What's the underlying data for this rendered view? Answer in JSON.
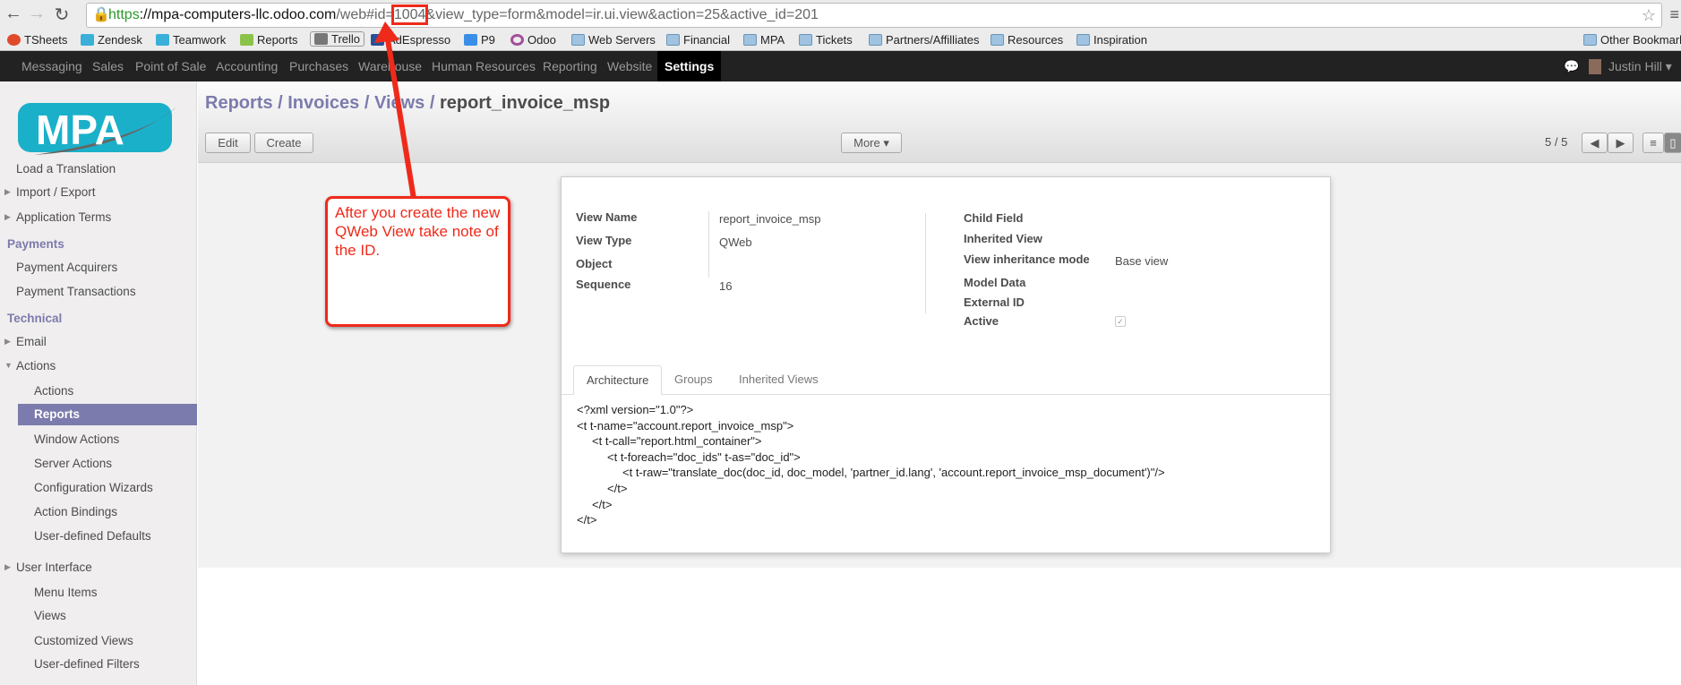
{
  "browser": {
    "url_scheme": "https",
    "url_host": "://mpa-computers-llc.odoo.com",
    "url_path": "/web#id=",
    "url_id": "1004",
    "url_rest": "&view_type=form&model=ir.ui.view&action=25&active_id=201",
    "bookmarks": [
      "TSheets",
      "Zendesk",
      "Teamwork",
      "Reports",
      "Trello",
      "AdEspresso",
      "P9",
      "Odoo",
      "Web Servers",
      "Financial",
      "MPA",
      "Tickets",
      "Partners/Affilliates",
      "Resources",
      "Inspiration"
    ],
    "other_bookmarks": "Other Bookmarks"
  },
  "topnav": {
    "items": [
      "Messaging",
      "Sales",
      "Point of Sale",
      "Accounting",
      "Purchases",
      "Warehouse",
      "Human Resources",
      "Reporting",
      "Website",
      "Settings"
    ],
    "active": "Settings",
    "user": "Justin Hill"
  },
  "sidebar": {
    "logo": "MPA",
    "items": [
      {
        "label": "Load a Translation",
        "type": "item"
      },
      {
        "label": "Import / Export",
        "type": "parent"
      },
      {
        "label": "Application Terms",
        "type": "parent"
      },
      {
        "label": "Payments",
        "type": "head"
      },
      {
        "label": "Payment Acquirers",
        "type": "item"
      },
      {
        "label": "Payment Transactions",
        "type": "item"
      },
      {
        "label": "Technical",
        "type": "head"
      },
      {
        "label": "Email",
        "type": "parent"
      },
      {
        "label": "Actions",
        "type": "open"
      },
      {
        "label": "Actions",
        "type": "sub"
      },
      {
        "label": "Reports",
        "type": "sub-active"
      },
      {
        "label": "Window Actions",
        "type": "sub"
      },
      {
        "label": "Server Actions",
        "type": "sub"
      },
      {
        "label": "Configuration Wizards",
        "type": "sub"
      },
      {
        "label": "Action Bindings",
        "type": "sub"
      },
      {
        "label": "User-defined Defaults",
        "type": "sub"
      },
      {
        "label": "User Interface",
        "type": "parent"
      },
      {
        "label": "Menu Items",
        "type": "sub"
      },
      {
        "label": "Views",
        "type": "sub"
      },
      {
        "label": "Customized Views",
        "type": "sub"
      },
      {
        "label": "User-defined Filters",
        "type": "sub"
      }
    ]
  },
  "breadcrumb": [
    "Reports",
    "Invoices",
    "Views"
  ],
  "breadcrumb_current": "report_invoice_msp",
  "toolbar": {
    "edit": "Edit",
    "create": "Create",
    "more": "More ▾",
    "pager": "5 / 5"
  },
  "form": {
    "left": [
      {
        "label": "View Name",
        "value": "report_invoice_msp"
      },
      {
        "label": "View Type",
        "value": "QWeb"
      },
      {
        "label": "Object",
        "value": ""
      },
      {
        "label": "Sequence",
        "value": "16"
      }
    ],
    "right": [
      {
        "label": "Child Field",
        "value": ""
      },
      {
        "label": "Inherited View",
        "value": ""
      },
      {
        "label": "View inheritance mode",
        "value": "Base view"
      },
      {
        "label": "Model Data",
        "value": ""
      },
      {
        "label": "External ID",
        "value": ""
      },
      {
        "label": "Active",
        "value": "✓"
      }
    ],
    "tabs": [
      "Architecture",
      "Groups",
      "Inherited Views"
    ],
    "active_tab": "Architecture",
    "code": [
      {
        "indent": 0,
        "text": "<?xml version=\"1.0\"?>"
      },
      {
        "indent": 0,
        "text": "<t t-name=\"account.report_invoice_msp\">"
      },
      {
        "indent": 1,
        "text": "<t t-call=\"report.html_container\">"
      },
      {
        "indent": 2,
        "text": "<t t-foreach=\"doc_ids\" t-as=\"doc_id\">"
      },
      {
        "indent": 3,
        "text": "<t t-raw=\"translate_doc(doc_id, doc_model, 'partner_id.lang', 'account.report_invoice_msp_document')\"/>"
      },
      {
        "indent": 2,
        "text": "</t>"
      },
      {
        "indent": 1,
        "text": "</t>"
      },
      {
        "indent": 0,
        "text": "</t>"
      }
    ]
  },
  "annotation": {
    "text": "After you create the new QWeb View take note of the ID.",
    "color": "#ef2a1a"
  },
  "colors": {
    "accent": "#7c7bad",
    "nav": "#222222",
    "logo": "#1bb0c9"
  }
}
